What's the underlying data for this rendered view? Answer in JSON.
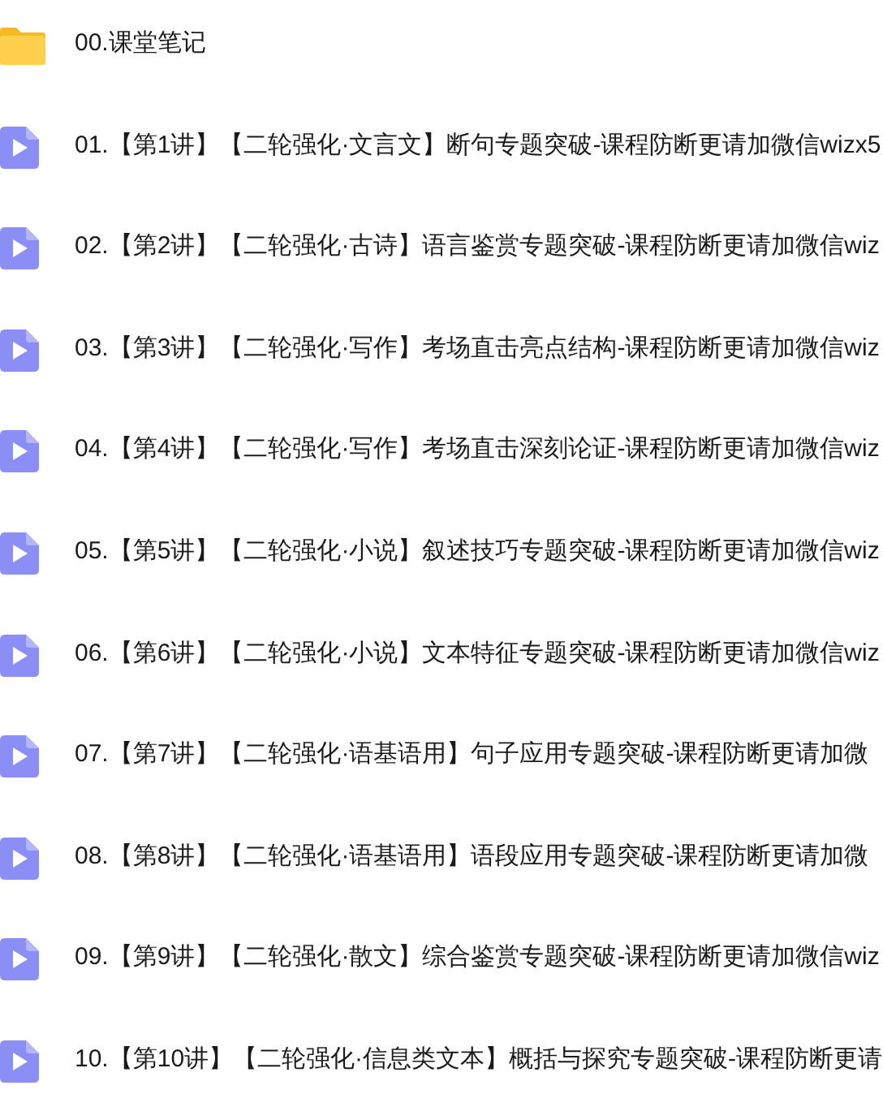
{
  "files": [
    {
      "kind": "folder",
      "name": "00.课堂笔记"
    },
    {
      "kind": "video",
      "name": "01.【第1讲】【二轮强化·文言文】断句专题突破-课程防断更请加微信wizx5"
    },
    {
      "kind": "video",
      "name": "02.【第2讲】【二轮强化·古诗】语言鉴赏专题突破-课程防断更请加微信wiz"
    },
    {
      "kind": "video",
      "name": "03.【第3讲】【二轮强化·写作】考场直击亮点结构-课程防断更请加微信wiz"
    },
    {
      "kind": "video",
      "name": "04.【第4讲】【二轮强化·写作】考场直击深刻论证-课程防断更请加微信wiz"
    },
    {
      "kind": "video",
      "name": "05.【第5讲】【二轮强化·小说】叙述技巧专题突破-课程防断更请加微信wiz"
    },
    {
      "kind": "video",
      "name": "06.【第6讲】【二轮强化·小说】文本特征专题突破-课程防断更请加微信wiz"
    },
    {
      "kind": "video",
      "name": "07.【第7讲】【二轮强化·语基语用】句子应用专题突破-课程防断更请加微"
    },
    {
      "kind": "video",
      "name": "08.【第8讲】【二轮强化·语基语用】语段应用专题突破-课程防断更请加微"
    },
    {
      "kind": "video",
      "name": "09.【第9讲】【二轮强化·散文】综合鉴赏专题突破-课程防断更请加微信wiz"
    },
    {
      "kind": "video",
      "name": "10.【第10讲】【二轮强化·信息类文本】概括与探究专题突破-课程防断更请"
    }
  ]
}
